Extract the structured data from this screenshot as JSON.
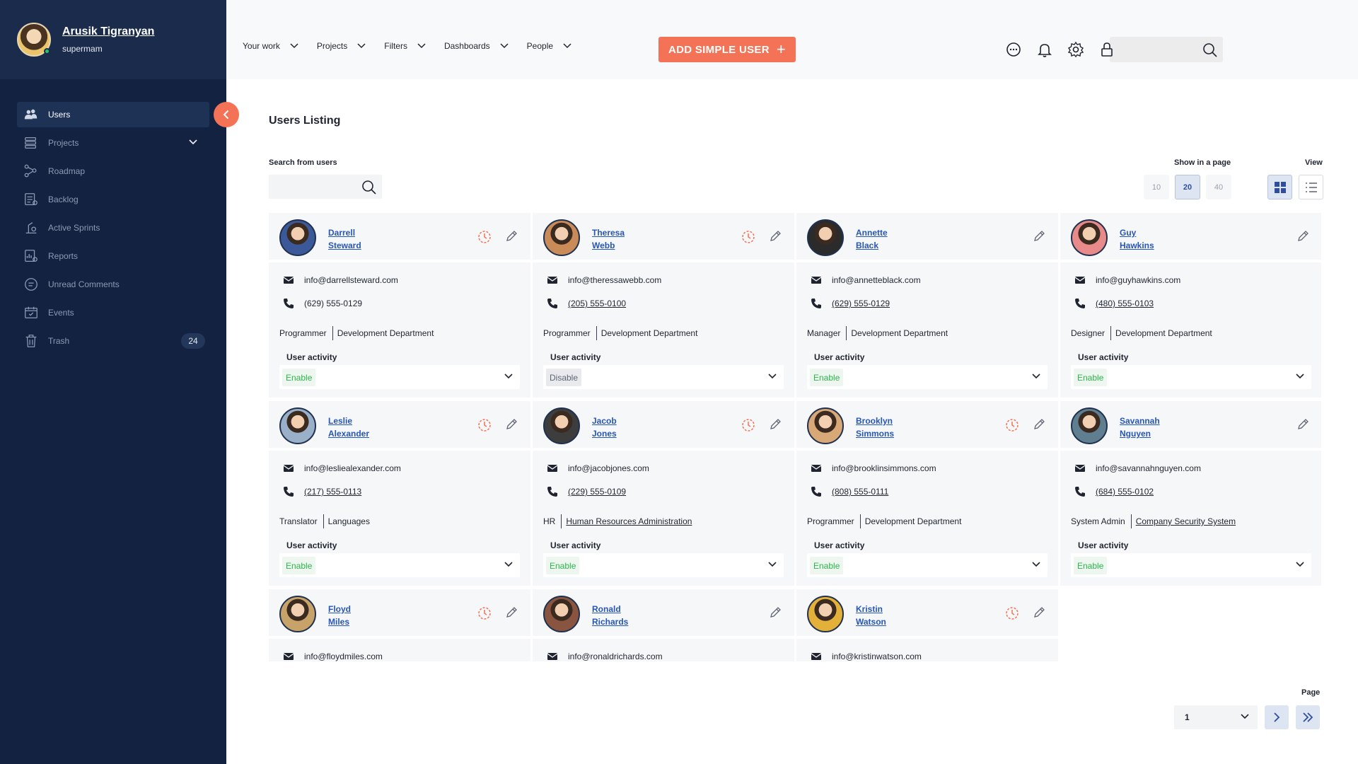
{
  "profile": {
    "name": "Arusik Tigranyan",
    "role": "supermam"
  },
  "sidebar": {
    "items": [
      {
        "label": "Users",
        "icon": "users-icon",
        "active": true
      },
      {
        "label": "Projects",
        "icon": "projects-icon",
        "has_chevron": true
      },
      {
        "label": "Roadmap",
        "icon": "roadmap-icon"
      },
      {
        "label": "Backlog",
        "icon": "backlog-icon"
      },
      {
        "label": "Active Sprints",
        "icon": "sprints-icon"
      },
      {
        "label": "Reports",
        "icon": "reports-icon"
      },
      {
        "label": "Unread Comments",
        "icon": "comments-icon"
      },
      {
        "label": "Events",
        "icon": "calendar-icon"
      },
      {
        "label": "Trash",
        "icon": "trash-icon",
        "count": "24"
      }
    ]
  },
  "header": {
    "menu": [
      "Your work",
      "Projects",
      "Filters",
      "Dashboards",
      "People"
    ],
    "add_button": "ADD SIMPLE USER",
    "search_placeholder": ""
  },
  "main": {
    "title": "Users Listing",
    "search_label": "Search from users",
    "show_label": "Show in a page",
    "page_sizes": [
      "10",
      "20",
      "40"
    ],
    "selected_page_size": "20",
    "view_label": "View",
    "activity_label": "User activity"
  },
  "users": [
    {
      "first": "Darrell",
      "last": "Steward",
      "email": "info@darrellsteward.com",
      "phone": "(629) 555-0129",
      "phone_link": false,
      "role": "Programmer",
      "dept": "Development Department",
      "dept_link": false,
      "activity": "Enable",
      "clock": true
    },
    {
      "first": "Theresa",
      "last": "Webb",
      "email": "info@theressawebb.com",
      "phone": "(205) 555-0100",
      "phone_link": true,
      "role": "Programmer",
      "dept": "Development Department",
      "dept_link": false,
      "activity": "Disable",
      "clock": true
    },
    {
      "first": "Annette",
      "last": "Black",
      "email": "info@annetteblack.com",
      "phone": "(629) 555-0129",
      "phone_link": true,
      "role": "Manager",
      "dept": "Development Department",
      "dept_link": false,
      "activity": "Enable",
      "clock": false
    },
    {
      "first": "Guy",
      "last": "Hawkins",
      "email": "info@guyhawkins.com",
      "phone": "(480) 555-0103",
      "phone_link": true,
      "role": "Designer",
      "dept": "Development Department",
      "dept_link": false,
      "activity": "Enable",
      "clock": false
    },
    {
      "first": "Leslie",
      "last": "Alexander",
      "email": "info@lesliealexander.com",
      "phone": "(217) 555-0113",
      "phone_link": true,
      "role": "Translator",
      "dept": "Languages",
      "dept_link": false,
      "activity": "Enable",
      "clock": true
    },
    {
      "first": "Jacob",
      "last": "Jones",
      "email": "info@jacobjones.com",
      "phone": "(229) 555-0109",
      "phone_link": true,
      "role": "HR",
      "dept": "Human Resources Administration",
      "dept_link": true,
      "activity": "Enable",
      "clock": true
    },
    {
      "first": "Brooklyn",
      "last": "Simmons",
      "email": "info@brooklinsimmons.com",
      "phone": "(808) 555-0111",
      "phone_link": true,
      "role": "Programmer",
      "dept": "Development Department",
      "dept_link": false,
      "activity": "Enable",
      "clock": true
    },
    {
      "first": "Savannah",
      "last": "Nguyen",
      "email": "info@savannahnguyen.com",
      "phone": "(684) 555-0102",
      "phone_link": true,
      "role": "System Admin",
      "dept": "Company Security System",
      "dept_link": true,
      "activity": "Enable",
      "clock": false
    },
    {
      "first": "Floyd",
      "last": "Miles",
      "email": "info@floydmiles.com",
      "clock": true
    },
    {
      "first": "Ronald",
      "last": "Richards",
      "email": "info@ronaldrichards.com",
      "clock": false
    },
    {
      "first": "Kristin",
      "last": "Watson",
      "email": "info@kristinwatson.com",
      "clock": true
    }
  ],
  "pagination": {
    "label": "Page",
    "current": "1"
  },
  "colors": {
    "accent": "#f47256",
    "sidebar": "#132240",
    "link": "#2656b8",
    "enable": "#2db44c"
  }
}
